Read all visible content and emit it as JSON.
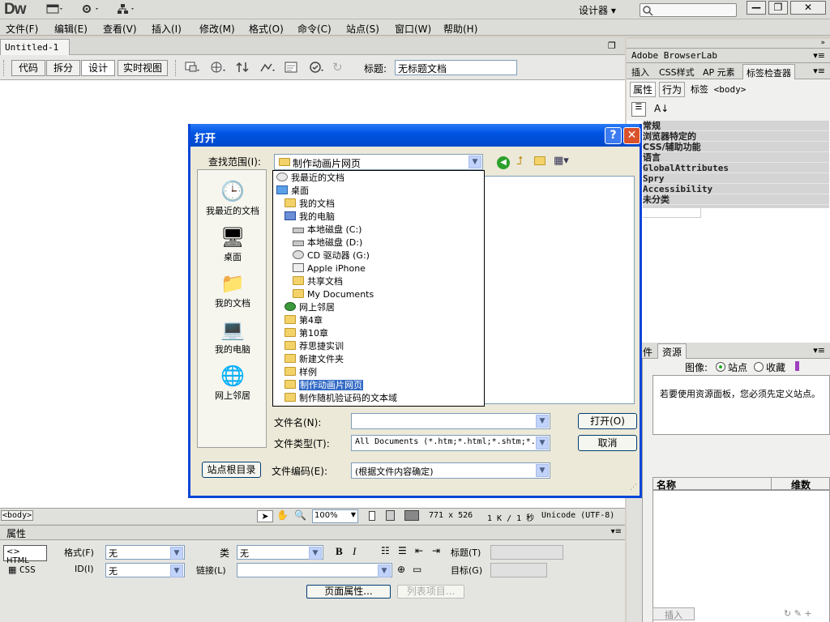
{
  "app": {
    "logo": "Dw",
    "workspace": "设计器",
    "workspace_arrow": "▾",
    "window_buttons": {
      "min": "—",
      "restore": "❐",
      "close": "✕"
    }
  },
  "menubar": [
    "文件(F)",
    "编辑(E)",
    "查看(V)",
    "插入(I)",
    "修改(M)",
    "格式(O)",
    "命令(C)",
    "站点(S)",
    "窗口(W)",
    "帮助(H)"
  ],
  "document": {
    "tab_name": "Untitled-1",
    "tab_close": "×",
    "view_buttons": [
      "代码",
      "拆分",
      "设计",
      "实时视图"
    ],
    "title_label": "标题:",
    "title_value": "无标题文档"
  },
  "right_panel": {
    "browserlab": "Adobe BrowserLab",
    "tabs": [
      "插入",
      "CSS样式",
      "AP 元素",
      "标签检查器"
    ],
    "subtabs": [
      "属性",
      "行为"
    ],
    "tag_label": "标签 <body>",
    "categories": [
      "常规",
      "浏览器特定的",
      "CSS/辅助功能",
      "语言",
      "GlobalAttributes",
      "Spry",
      "Accessibility",
      "未分类"
    ],
    "files_tabs": [
      "件",
      "资源"
    ],
    "image_label": "图像:",
    "radio_site": "站点",
    "radio_fav": "收藏",
    "message": "若要使用资源面板，您必须先定义站点。",
    "col_name": "名称",
    "col_dim": "维数",
    "insert_btn": "插入"
  },
  "dialog": {
    "title": "打开",
    "help": "?",
    "close": "✕",
    "lookin_label": "查找范围(I):",
    "lookin_value": "制作动画片网页",
    "places": [
      "我最近的文档",
      "桌面",
      "我的文档",
      "我的电脑",
      "网上邻居"
    ],
    "dropdown_items": [
      {
        "label": "我最近的文档",
        "indent": 0,
        "icon": "recent"
      },
      {
        "label": "桌面",
        "indent": 0,
        "icon": "desktop"
      },
      {
        "label": "我的文档",
        "indent": 1,
        "icon": "folder"
      },
      {
        "label": "我的电脑",
        "indent": 1,
        "icon": "computer"
      },
      {
        "label": "本地磁盘 (C:)",
        "indent": 2,
        "icon": "drive"
      },
      {
        "label": "本地磁盘 (D:)",
        "indent": 2,
        "icon": "drive"
      },
      {
        "label": "CD 驱动器 (G:)",
        "indent": 2,
        "icon": "cd"
      },
      {
        "label": "Apple iPhone",
        "indent": 2,
        "icon": "device"
      },
      {
        "label": "共享文档",
        "indent": 2,
        "icon": "folder"
      },
      {
        "label": "My Documents",
        "indent": 2,
        "icon": "folder"
      },
      {
        "label": "网上邻居",
        "indent": 1,
        "icon": "network"
      },
      {
        "label": "第4章",
        "indent": 1,
        "icon": "folder"
      },
      {
        "label": "第10章",
        "indent": 1,
        "icon": "folder"
      },
      {
        "label": "荐思捷实训",
        "indent": 1,
        "icon": "folder"
      },
      {
        "label": "新建文件夹",
        "indent": 1,
        "icon": "folder"
      },
      {
        "label": "样例",
        "indent": 1,
        "icon": "folder"
      },
      {
        "label": "制作动画片网页",
        "indent": 1,
        "icon": "folder",
        "selected": true
      },
      {
        "label": "制作随机验证码的文本域",
        "indent": 1,
        "icon": "folder"
      }
    ],
    "filename_label": "文件名(N):",
    "filename_value": "",
    "filetype_label": "文件类型(T):",
    "filetype_value": "All Documents (*.htm;*.html;*.shtm;*.",
    "open_btn": "打开(O)",
    "cancel_btn": "取消",
    "site_root_btn": "站点根目录",
    "encoding_label": "文件编码(E):",
    "encoding_value": "(根据文件内容确定)"
  },
  "statusbar": {
    "tag": "<body>",
    "zoom": "100%",
    "size": "771 x 526",
    "download": "1 K / 1 秒",
    "encoding": "Unicode (UTF-8)"
  },
  "properties": {
    "title": "属性",
    "html_btn": "<> HTML",
    "css_btn": "CSS",
    "format_label": "格式(F)",
    "format_value": "无",
    "class_label": "类",
    "class_value": "无",
    "id_label": "ID(I)",
    "id_value": "无",
    "link_label": "链接(L)",
    "title_label": "标题(T)",
    "target_label": "目标(G)",
    "page_props_btn": "页面属性...",
    "list_items_btn": "列表项目..."
  }
}
